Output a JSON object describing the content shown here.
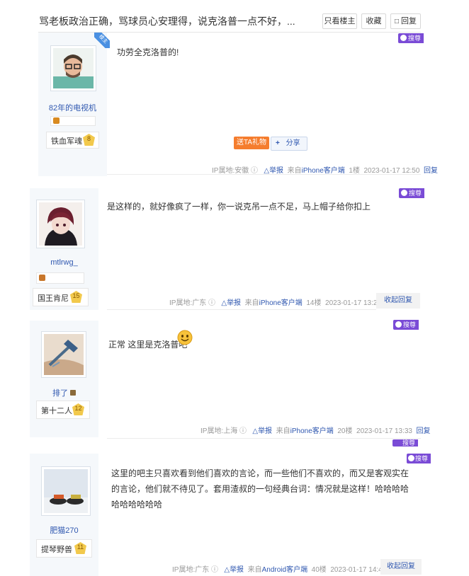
{
  "thread": {
    "title": "骂老板政治正确，骂球员心安理得，说克洛普一点不好，...",
    "buttons": {
      "only_op": "只看楼主",
      "favorite": "收藏",
      "reply": "回复"
    }
  },
  "labels": {
    "ip_prefix": "IP属地:",
    "report": "举报",
    "from_prefix": "来自",
    "reply": "回复",
    "collapse_reply": "收起回复",
    "jubao_badge": "搜尊",
    "op_badge": "楼主",
    "gift": "送TA礼物",
    "share": "分享"
  },
  "posts": [
    {
      "username": "82年的电视机",
      "level_name": "铁血军魂",
      "level": "8",
      "content": "功劳全克洛普的!",
      "ip": "安徽",
      "client": "iPhone客户端",
      "floor": "1楼",
      "time": "2023-01-17 12:50",
      "is_op": true
    },
    {
      "username": "mtlrwg_",
      "level_name": "国王肯尼",
      "level": "15",
      "content": "是这样的，就好像疯了一样，你一说克吊一点不足，马上帽子给你扣上",
      "ip": "广东",
      "client": "iPhone客户端",
      "floor": "14楼",
      "time": "2023-01-17 13:20"
    },
    {
      "username": "排了",
      "level_name": "第十二人",
      "level": "12",
      "content": "正常 这里是克洛普吧",
      "ip": "上海",
      "client": "iPhone客户端",
      "floor": "20楼",
      "time": "2023-01-17 13:33"
    },
    {
      "username": "肥猫270",
      "level_name": "提琴野兽",
      "level": "11",
      "content": "这里的吧主只喜欢看到他们喜欢的言论，而一些他们不喜欢的，而又是客观实在的言论，他们就不待见了。套用渣叔的一句经典台词：情况就是这样！哈哈哈哈哈哈哈哈哈哈",
      "ip": "广东",
      "client": "Android客户端",
      "floor": "40楼",
      "time": "2023-01-17 14:49"
    }
  ],
  "colors": {
    "link": "#3058b0",
    "jubao": "#7a4bd6",
    "gift": "#f57d2e",
    "level_badge": "#f2c94c"
  }
}
